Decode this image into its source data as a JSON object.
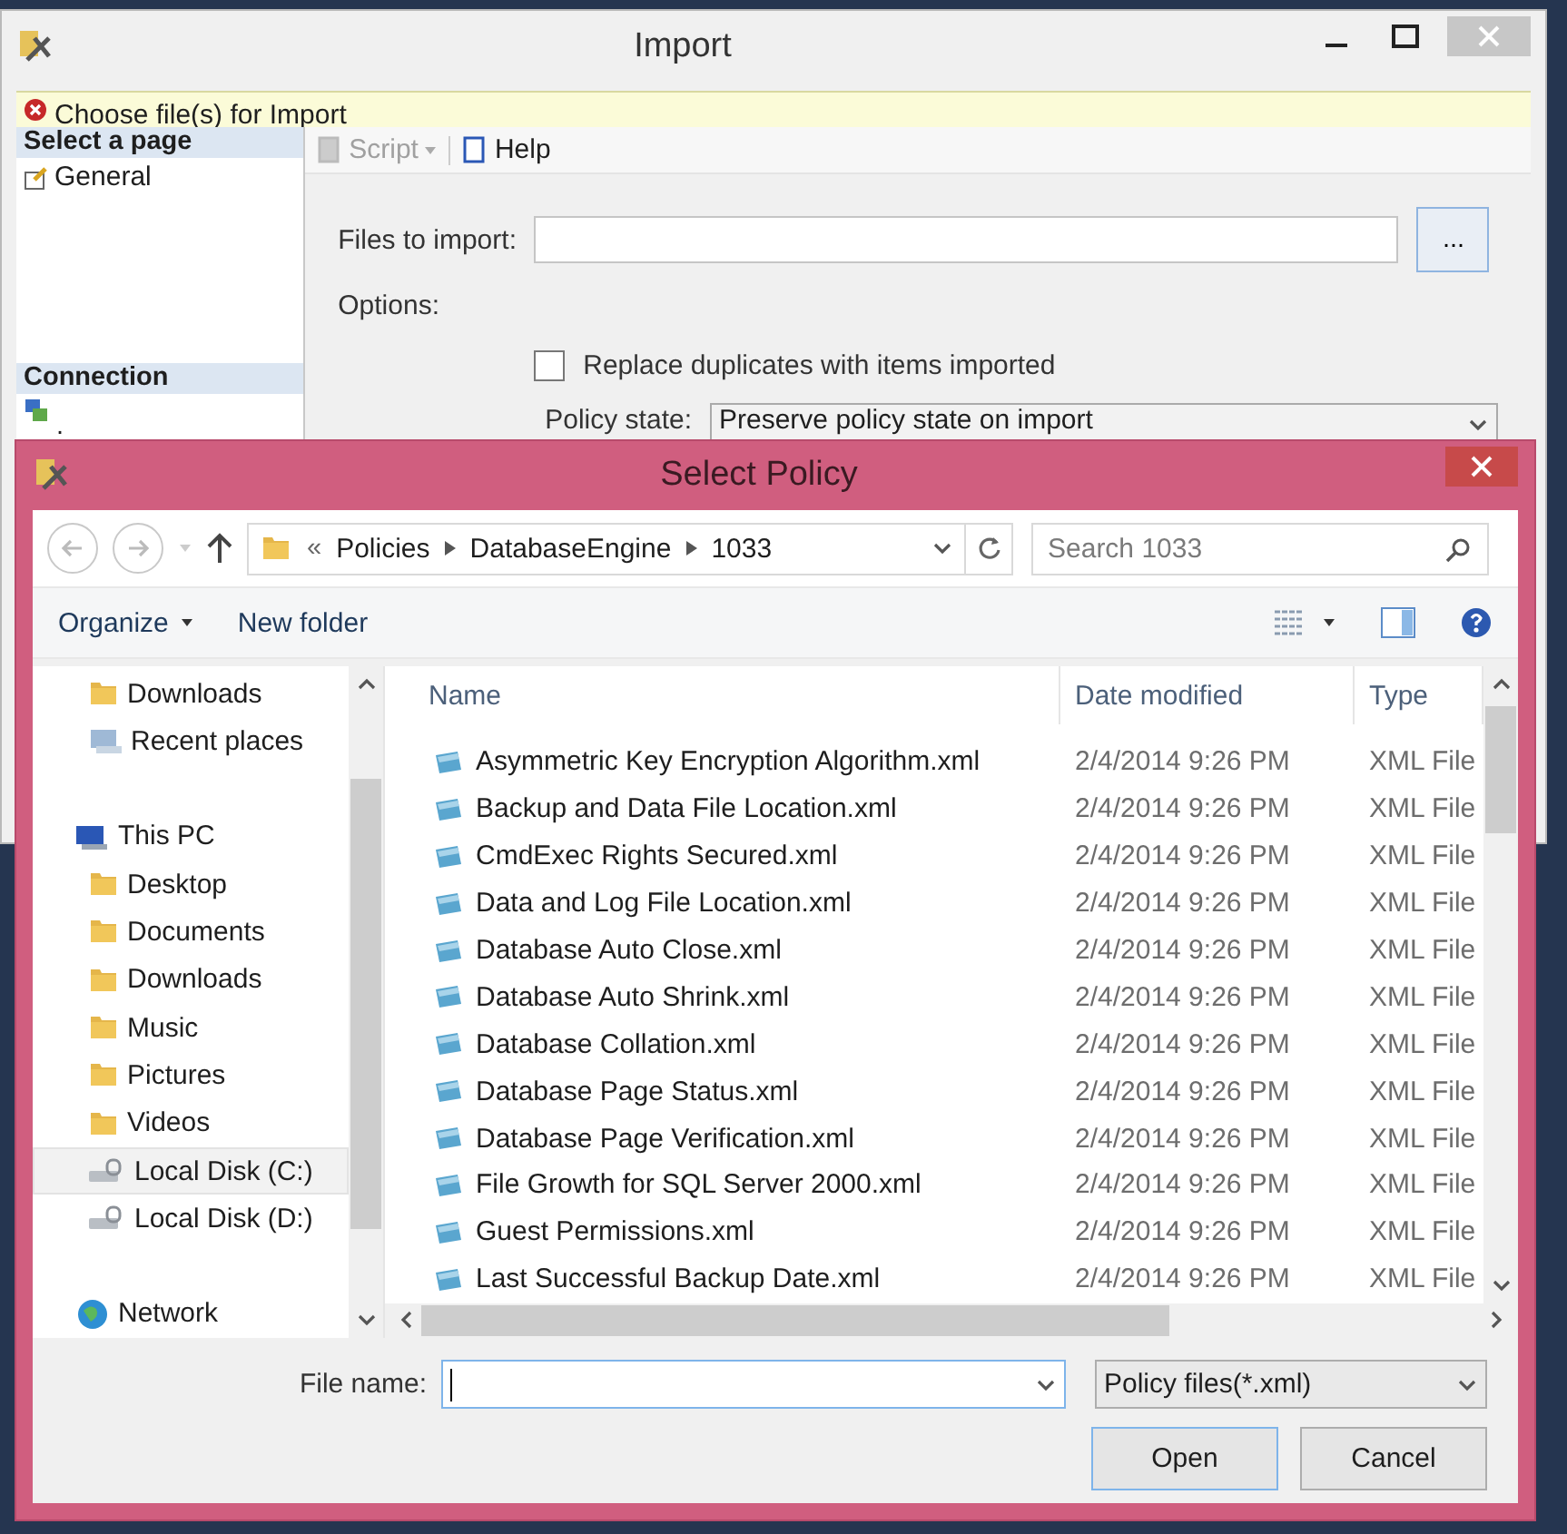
{
  "import_window": {
    "title": "Import",
    "message": "Choose file(s) for Import",
    "select_page": {
      "header": "Select a page",
      "items": [
        {
          "label": "General",
          "selected": false
        }
      ]
    },
    "connection": {
      "header": "Connection",
      "item": "."
    },
    "toolbar": [
      {
        "label": "Script",
        "disabled": true,
        "kind": "split"
      },
      {
        "label": "Help",
        "disabled": false,
        "kind": "plain"
      }
    ],
    "files_to_import": {
      "label": "Files to import:",
      "browse": "..."
    },
    "options_label": "Options:",
    "replace_duplicates": {
      "label": "Replace duplicates with items imported",
      "checked": false
    },
    "policy_state": {
      "label": "Policy state:",
      "value": "Preserve policy state on import"
    }
  },
  "dialog": {
    "title": "Select Policy",
    "breadcrumb": {
      "overflow": "«",
      "parts": [
        "Policies",
        "DatabaseEngine",
        "1033"
      ]
    },
    "search": {
      "placeholder": "Search 1033"
    },
    "organize": "Organize",
    "new_folder": "New folder",
    "nav": [
      {
        "label": "Downloads",
        "kind": "folder",
        "selected": false
      },
      {
        "label": "Recent places",
        "kind": "recent",
        "selected": false
      },
      {
        "label": "This PC",
        "kind": "pc",
        "selected": false
      },
      {
        "label": "Desktop",
        "kind": "folder",
        "selected": false
      },
      {
        "label": "Documents",
        "kind": "folder",
        "selected": false
      },
      {
        "label": "Downloads",
        "kind": "folder",
        "selected": false
      },
      {
        "label": "Music",
        "kind": "folder",
        "selected": false
      },
      {
        "label": "Pictures",
        "kind": "folder",
        "selected": false
      },
      {
        "label": "Videos",
        "kind": "folder",
        "selected": false
      },
      {
        "label": "Local Disk (C:)",
        "kind": "disk",
        "selected": true
      },
      {
        "label": "Local Disk (D:)",
        "kind": "disk",
        "selected": false
      },
      {
        "label": "Network",
        "kind": "network",
        "selected": false
      }
    ],
    "columns": [
      "Name",
      "Date modified",
      "Type"
    ],
    "files": [
      {
        "name": "Asymmetric Key Encryption Algorithm.xml",
        "date": "2/4/2014 9:26 PM",
        "type": "XML File"
      },
      {
        "name": "Backup and Data File Location.xml",
        "date": "2/4/2014 9:26 PM",
        "type": "XML File"
      },
      {
        "name": "CmdExec Rights Secured.xml",
        "date": "2/4/2014 9:26 PM",
        "type": "XML File"
      },
      {
        "name": "Data and Log File Location.xml",
        "date": "2/4/2014 9:26 PM",
        "type": "XML File"
      },
      {
        "name": "Database Auto Close.xml",
        "date": "2/4/2014 9:26 PM",
        "type": "XML File"
      },
      {
        "name": "Database Auto Shrink.xml",
        "date": "2/4/2014 9:26 PM",
        "type": "XML File"
      },
      {
        "name": "Database Collation.xml",
        "date": "2/4/2014 9:26 PM",
        "type": "XML File"
      },
      {
        "name": "Database Page Status.xml",
        "date": "2/4/2014 9:26 PM",
        "type": "XML File"
      },
      {
        "name": "Database Page Verification.xml",
        "date": "2/4/2014 9:26 PM",
        "type": "XML File"
      },
      {
        "name": "File Growth for SQL Server 2000.xml",
        "date": "2/4/2014 9:26 PM",
        "type": "XML File"
      },
      {
        "name": "Guest Permissions.xml",
        "date": "2/4/2014 9:26 PM",
        "type": "XML File"
      },
      {
        "name": "Last Successful Backup Date.xml",
        "date": "2/4/2014 9:26 PM",
        "type": "XML File"
      }
    ],
    "file_name": {
      "label": "File name:"
    },
    "file_type": "Policy files(*.xml)",
    "buttons": [
      {
        "label": "Open",
        "default": true
      },
      {
        "label": "Cancel",
        "default": false
      }
    ]
  }
}
